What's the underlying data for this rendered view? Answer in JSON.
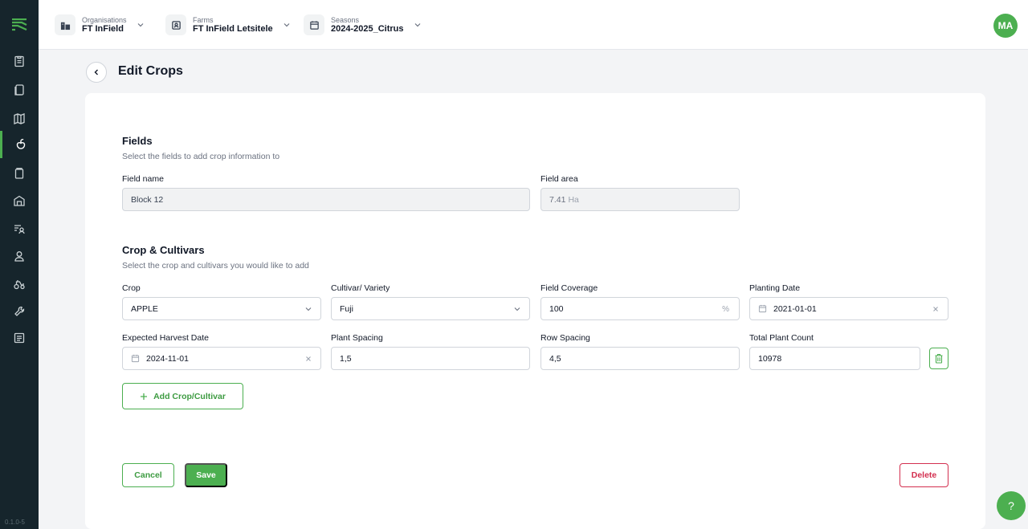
{
  "app": {
    "version": "0.1.0-5"
  },
  "topbar": {
    "organisation": {
      "label": "Organisations",
      "value": "FT InField"
    },
    "farm": {
      "label": "Farms",
      "value": "FT InField Letsitele"
    },
    "season": {
      "label": "Seasons",
      "value": "2024-2025_Citrus"
    },
    "avatar_initials": "MA"
  },
  "page": {
    "title": "Edit Crops"
  },
  "fields_section": {
    "title": "Fields",
    "subtitle": "Select the fields to add crop information to",
    "field_name_label": "Field name",
    "field_name_value": "Block 12",
    "field_area_label": "Field area",
    "field_area_value": "7.41",
    "field_area_unit": "Ha"
  },
  "crop_section": {
    "title": "Crop & Cultivars",
    "subtitle": "Select the crop and cultivars you would like to add",
    "crop_label": "Crop",
    "crop_value": "APPLE",
    "cultivar_label": "Cultivar/ Variety",
    "cultivar_value": "Fuji",
    "coverage_label": "Field Coverage",
    "coverage_value": "100",
    "coverage_unit": "%",
    "planting_date_label": "Planting Date",
    "planting_date_value": "2021-01-01",
    "harvest_date_label": "Expected Harvest Date",
    "harvest_date_value": "2024-11-01",
    "plant_spacing_label": "Plant Spacing",
    "plant_spacing_value": "1,5",
    "row_spacing_label": "Row Spacing",
    "row_spacing_value": "4,5",
    "plant_count_label": "Total Plant Count",
    "plant_count_value": "10978",
    "add_button": "Add Crop/Cultivar"
  },
  "actions": {
    "cancel": "Cancel",
    "save": "Save",
    "delete": "Delete"
  },
  "help": {
    "label": "?"
  },
  "colors": {
    "accent": "#4caf50",
    "sidebar": "#16252c",
    "danger": "#d32f4f"
  },
  "sidebar": {
    "items": [
      {
        "icon": "clipboard-icon"
      },
      {
        "icon": "copy-icon"
      },
      {
        "icon": "map-icon"
      },
      {
        "icon": "crop-icon",
        "active": true
      },
      {
        "icon": "bin-icon"
      },
      {
        "icon": "barn-icon"
      },
      {
        "icon": "filter-user-icon"
      },
      {
        "icon": "user-icon"
      },
      {
        "icon": "tractor-icon"
      },
      {
        "icon": "wrench-icon"
      },
      {
        "icon": "report-icon"
      }
    ]
  }
}
